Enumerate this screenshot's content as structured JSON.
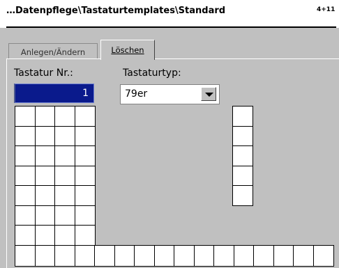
{
  "header": {
    "title": "…Datenpflege\\Tastaturtemplates\\Standard",
    "page_info": "4+11"
  },
  "tabs": [
    {
      "label": "Anlegen/Ändern"
    },
    {
      "label": "Löschen"
    }
  ],
  "form": {
    "keyboard_number_label": "Tastatur Nr.:",
    "keyboard_number_value": "1",
    "keyboard_type_label": "Tastaturtyp:",
    "keyboard_type_value": "79er"
  },
  "keyboard_grid": {
    "left_block": {
      "columns": 4,
      "rows": 7
    },
    "right_column": {
      "rows": 5
    },
    "bottom_row": {
      "cells": 16
    }
  },
  "colors": {
    "selected_field_bg": "#0a1a8c",
    "panel_bg": "#c0c0c0"
  }
}
